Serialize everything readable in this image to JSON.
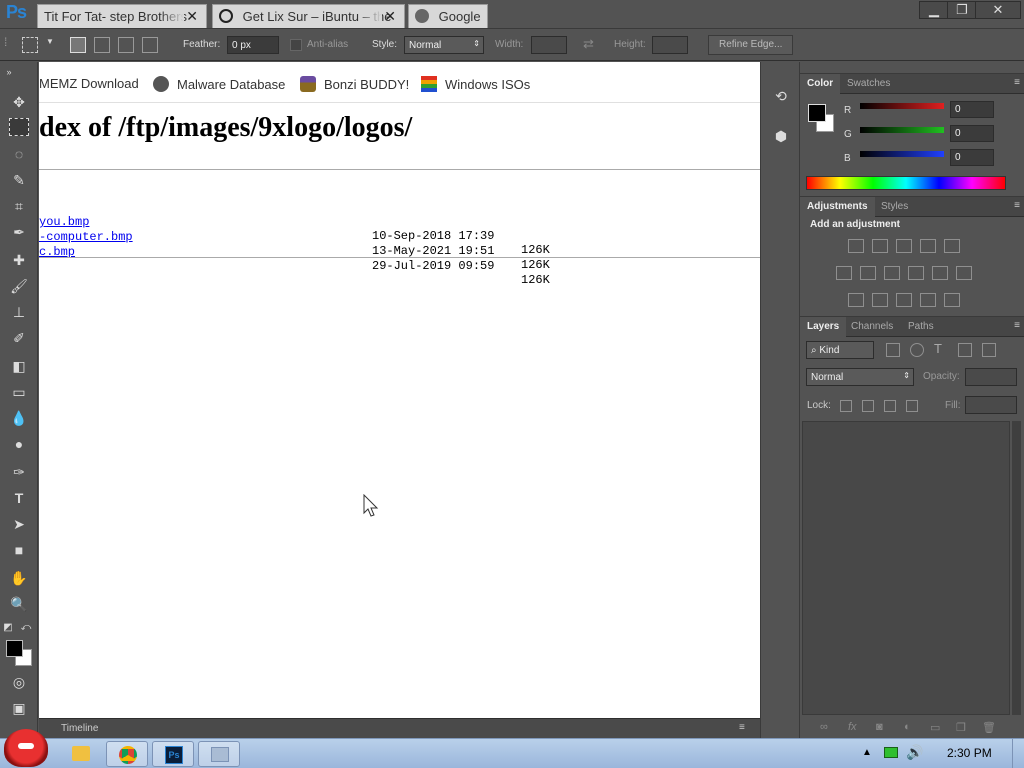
{
  "app": {
    "logo": "Ps"
  },
  "tabs": [
    {
      "label": "Tit For Tat- step Brothers",
      "close": "✕"
    },
    {
      "label": "Get Lix Sur – iBuntu – the",
      "close": "✕"
    },
    {
      "label": "Google"
    }
  ],
  "window_controls": {
    "minimize": "▁",
    "restore": "❐",
    "close": "✕"
  },
  "options_bar": {
    "feather_label": "Feather:",
    "feather_value": "0 px",
    "antialias_label": "Anti-alias",
    "style_label": "Style:",
    "style_value": "Normal",
    "width_label": "Width:",
    "height_label": "Height:",
    "refine_edge": "Refine Edge..."
  },
  "bookmarks": [
    {
      "label": "MEMZ Download"
    },
    {
      "label": "Malware Database"
    },
    {
      "label": "Bonzi BUDDY!"
    },
    {
      "label": "Windows ISOs"
    }
  ],
  "page": {
    "heading": "dex of /ftp/images/9xlogo/logos/",
    "files": [
      {
        "name": "you.bmp",
        "date": "10-Sep-2018 17:39",
        "size": "126K"
      },
      {
        "name": "-computer.bmp",
        "date": "13-May-2021 19:51",
        "size": "126K"
      },
      {
        "name": "c.bmp",
        "date": "29-Jul-2019 09:59",
        "size": "126K"
      }
    ]
  },
  "timeline": {
    "label": "Timeline"
  },
  "color_panel": {
    "tabs": [
      "Color",
      "Swatches"
    ],
    "channels": [
      {
        "label": "R",
        "value": "0",
        "color": "#e02020"
      },
      {
        "label": "G",
        "value": "0",
        "color": "#20c020"
      },
      {
        "label": "B",
        "value": "0",
        "color": "#2040ff"
      }
    ]
  },
  "adjustments_panel": {
    "tabs": [
      "Adjustments",
      "Styles"
    ],
    "title": "Add an adjustment"
  },
  "layers_panel": {
    "tabs": [
      "Layers",
      "Channels",
      "Paths"
    ],
    "filter_kind": "Kind",
    "blend_mode": "Normal",
    "opacity_label": "Opacity:",
    "lock_label": "Lock:",
    "fill_label": "Fill:"
  },
  "taskbar": {
    "clock": "2:30 PM"
  },
  "colors": {
    "foreground": "#000000",
    "background": "#ffffff",
    "ps_blue": "#2a84d4"
  }
}
